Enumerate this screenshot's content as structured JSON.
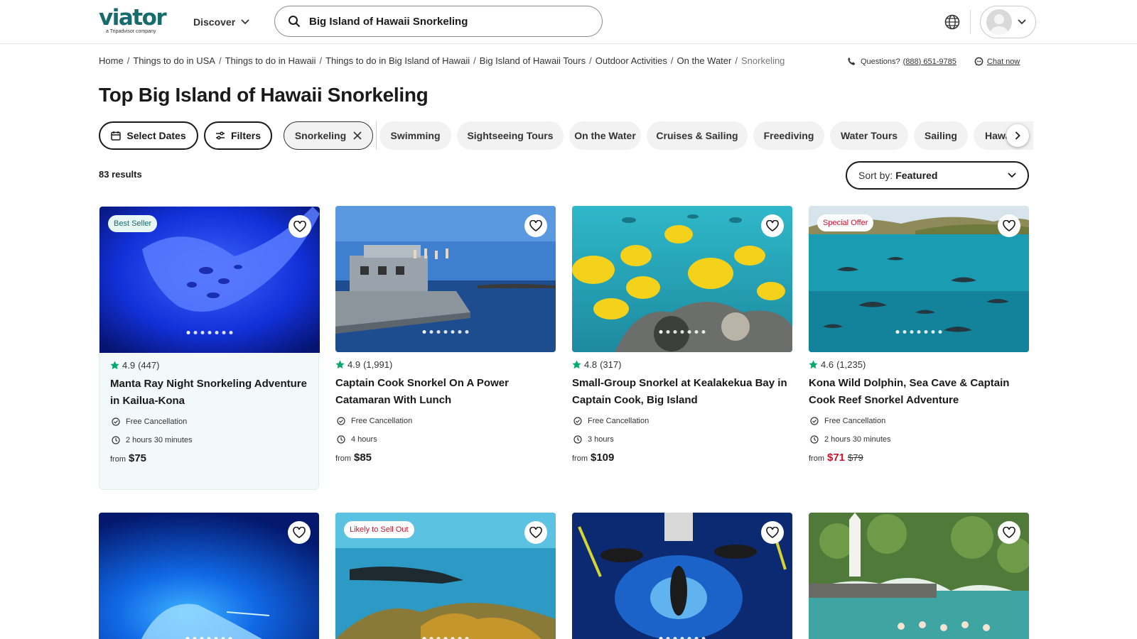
{
  "header": {
    "logo_word": "viator",
    "logo_sub": "a Tripadvisor company",
    "discover_label": "Discover",
    "search_value": "Big Island of Hawaii Snorkeling",
    "search_placeholder": "Search"
  },
  "breadcrumb": {
    "items": [
      "Home",
      "Things to do in USA",
      "Things to do in Hawaii",
      "Things to do in Big Island of Hawaii",
      "Big Island of Hawaii Tours",
      "Outdoor Activities",
      "On the Water"
    ],
    "current": "Snorkeling",
    "separator": "/"
  },
  "contact": {
    "questions_label": "Questions?",
    "phone": "(888) 651-9785",
    "chat_label": "Chat now"
  },
  "page_title": "Top Big Island of Hawaii Snorkeling",
  "filters": {
    "select_dates": "Select Dates",
    "filters": "Filters",
    "active_chip": "Snorkeling",
    "chips": [
      "Swimming",
      "Sightseeing Tours",
      "On the Water",
      "Cruises & Sailing",
      "Freediving",
      "Water Tours",
      "Sailing",
      "Hawaii"
    ]
  },
  "results": {
    "count_text": "83 results",
    "sort_label": "Sort by:",
    "sort_value": "Featured"
  },
  "cards": [
    {
      "badge": "Best Seller",
      "rating": "4.9",
      "reviews": "(447)",
      "title": "Manta Ray Night Snorkeling Adventure in Kailua-Kona",
      "cancellation": "Free Cancellation",
      "duration": "2 hours 30 minutes",
      "from_label": "from",
      "price": "$75"
    },
    {
      "rating": "4.9",
      "reviews": "(1,991)",
      "title": "Captain Cook Snorkel On A Power Catamaran With Lunch",
      "cancellation": "Free Cancellation",
      "duration": "4 hours",
      "from_label": "from",
      "price": "$85"
    },
    {
      "rating": "4.8",
      "reviews": "(317)",
      "title": "Small-Group Snorkel at Kealakekua Bay in Captain Cook, Big Island",
      "cancellation": "Free Cancellation",
      "duration": "3 hours",
      "from_label": "from",
      "price": "$109"
    },
    {
      "badge": "Special Offer",
      "rating": "4.6",
      "reviews": "(1,235)",
      "title": "Kona Wild Dolphin, Sea Cave & Captain Cook Reef Snorkel Adventure",
      "cancellation": "Free Cancellation",
      "duration": "2 hours 30 minutes",
      "from_label": "from",
      "price": "$71",
      "original_price": "$79"
    }
  ],
  "second_row": [
    {},
    {
      "badge": "Likely to Sell Out"
    },
    {},
    {}
  ],
  "colors": {
    "brand": "#186b6d",
    "star": "#00aa6c",
    "sale": "#d0112b"
  }
}
